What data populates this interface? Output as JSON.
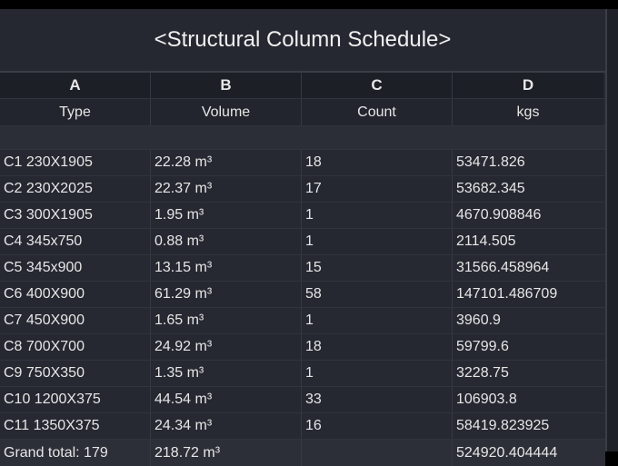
{
  "title": "<Structural Column Schedule>",
  "columns": [
    {
      "letter": "A",
      "name": "Type"
    },
    {
      "letter": "B",
      "name": "Volume"
    },
    {
      "letter": "C",
      "name": "Count"
    },
    {
      "letter": "D",
      "name": "kgs"
    }
  ],
  "rows": [
    [
      "C1 230X1905",
      "22.28 m³",
      "18",
      "53471.826"
    ],
    [
      "C2 230X2025",
      "22.37 m³",
      "17",
      "53682.345"
    ],
    [
      "C3 300X1905",
      "1.95 m³",
      "1",
      "4670.908846"
    ],
    [
      "C4 345x750",
      "0.88 m³",
      "1",
      "2114.505"
    ],
    [
      "C5 345x900",
      "13.15 m³",
      "15",
      "31566.458964"
    ],
    [
      "C6 400X900",
      "61.29 m³",
      "58",
      "147101.486709"
    ],
    [
      "C7 450X900",
      "1.65 m³",
      "1",
      "3960.9"
    ],
    [
      "C8 700X700",
      "24.92 m³",
      "18",
      "59799.6"
    ],
    [
      "C9 750X350",
      "1.35 m³",
      "1",
      "3228.75"
    ],
    [
      "C10 1200X375",
      "44.54 m³",
      "33",
      "106903.8"
    ],
    [
      "C11 1350X375",
      "24.34 m³",
      "16",
      "58419.823925"
    ]
  ],
  "total": {
    "label": "Grand total: 179",
    "volume": "218.72 m³",
    "count": "",
    "kgs": "524920.404444"
  }
}
